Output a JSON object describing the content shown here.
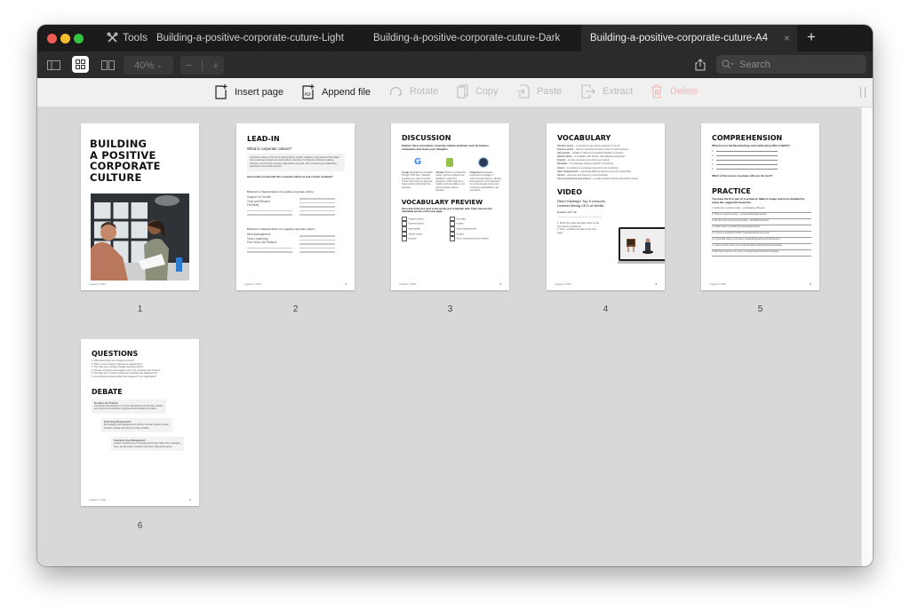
{
  "window": {
    "tools_label": "Tools",
    "tabs": [
      {
        "label": "Building-a-positive-corporate-cuture-Light",
        "active": false
      },
      {
        "label": "Building-a-positive-corporate-cuture-Dark",
        "active": false
      },
      {
        "label": "Building-a-positive-corporate-cuture-A4",
        "active": true
      }
    ],
    "close_glyph": "×",
    "new_tab_glyph": "+"
  },
  "toolbar": {
    "zoom_value": "40%",
    "zoom_out": "−",
    "zoom_in": "+",
    "search_placeholder": "Search"
  },
  "actions": [
    {
      "label": "Insert page",
      "icon": "insert-page-icon",
      "state": "enabled"
    },
    {
      "label": "Append file",
      "icon": "append-pdf-icon",
      "state": "enabled"
    },
    {
      "label": "Rotate",
      "icon": "rotate-icon",
      "state": "disabled"
    },
    {
      "label": "Copy",
      "icon": "copy-icon",
      "state": "disabled"
    },
    {
      "label": "Paste",
      "icon": "paste-icon",
      "state": "disabled"
    },
    {
      "label": "Extract",
      "icon": "extract-icon",
      "state": "disabled"
    },
    {
      "label": "Delete",
      "icon": "trash-icon",
      "state": "disabled"
    }
  ],
  "colors": {
    "titlebar": "#1b1b1b",
    "toolbar": "#2b2b2b",
    "canvas": "#d8d8d8",
    "delete_disabled": "#f1b9b9"
  },
  "pages": [
    {
      "number": "1",
      "title_lines": [
        "BUILDING",
        "A POSITIVE",
        "CORPORATE",
        "CULTURE"
      ],
      "footer": "Linguaco © 2024"
    },
    {
      "number": "2",
      "title": "LEAD-IN",
      "subtitle": "What is corporate culture?",
      "box_text": "Corporate culture is the set of shared values, beliefs, attitudes, and practices that shape how employees interact and work within a company. It influences decision-making, behavior, and how the company approaches its goals, often impacting job satisfaction, teamwork, and overall success.",
      "question": "How would you describe the corporate culture at your current company?",
      "positive_heading": "Brainstorm characteristics of a positive corporate culture:",
      "positive_items": [
        "Support for Growth",
        "Trust and Respect",
        "Flexibility"
      ],
      "negative_heading": "Brainstorm characteristics of a negative corporate culture:",
      "negative_items": [
        "Micromanagement",
        "Toxic Leadership",
        "Poor Work-Life Balance"
      ],
      "page_label": "2",
      "footer": "Linguaco © 2024"
    },
    {
      "number": "3",
      "title": "DISCUSSION",
      "intro": "Explore these innovative corporate culture methods used by famous companies and share your thoughts.",
      "companies": [
        {
          "name": "Google",
          "text": "Emphasizes innovation through \"20% time,\" allowing employees to spend a portion of their work hours on personal projects that could benefit the company."
        },
        {
          "name": "Shopify",
          "text": "Fosters a remote-first culture, giving employees the flexibility to work from anywhere, which supports a healthy work-life balance and accommodates diverse lifestyles."
        },
        {
          "name": "Patagonia",
          "text": "Encourages employees to engage in environmental activism, offering them paid time off to volunteer for environmental causes and promoting sustainability in all operations."
        }
      ],
      "vocab_title": "VOCABULARY PREVIEW",
      "vocab_intro": "Put a tick in the box next to the words you're familiar with. Then, discuss the unfamiliar words on the next page.",
      "vocab_left": [
        "Vacation policy",
        "Expense policy",
        "Appropriate",
        "Global culture",
        "Expand"
      ],
      "vocab_right": [
        "Stimulate",
        "Inspire",
        "Open disagreement",
        "Candor",
        "Act in (someone's) best interest"
      ],
      "page_label": "3",
      "footer": "Linguaco © 2024"
    },
    {
      "number": "4",
      "title": "VOCABULARY",
      "definitions": [
        {
          "term": "Vacation policy",
          "def": "a company's rules about employees' time off"
        },
        {
          "term": "Expense policy",
          "def": "rules on spending company money for work purposes"
        },
        {
          "term": "Appropriate",
          "def": "suitable or fitting for a particular situation or purpose"
        },
        {
          "term": "Global culture",
          "def": "a workplace with diverse, international perspectives"
        },
        {
          "term": "Expand",
          "def": "to grow a business and enter new markets"
        },
        {
          "term": "Stimulate",
          "def": "to encourage activity or growth in something"
        },
        {
          "term": "Inspire",
          "def": "to motivate or encourage someone to do something"
        },
        {
          "term": "Open disagreement",
          "def": "expressing differing opinions freely and respectfully"
        },
        {
          "term": "Candor",
          "def": "openness and honesty in communication"
        },
        {
          "term": "Act in (someone's) best interest",
          "def": "to make decisions that benefit another person"
        }
      ],
      "video_title": "VIDEO",
      "video_heading": "Reed Hasting's Top 5 Lessons Learned Being CEO of Netflix",
      "duration": "Duration 3:37 min",
      "steps": [
        "Watch the video and take notes on the five lessons mentioned.",
        "Then, complete the task on the next page."
      ],
      "page_label": "4",
      "footer": "Linguaco © 2024"
    },
    {
      "number": "5",
      "title": "COMPREHENSION",
      "question": "What lessons did Reed Hastings learn while being CEO of Netflix?",
      "blanks": [
        "1.",
        "2.",
        "3.",
        "4.",
        "5."
      ],
      "resonate": "Which of the lessons resonates with you the most?",
      "practice_title": "PRACTICE",
      "practice_intro": "You have the first part of a sentence. Make it longer and more detailed by using the suggested keywords.",
      "practice_items": [
        "1. Netflix has no vacation policy... (you/take/time off/needs)",
        "2. There's no expense policy... (you/spend/think/appropriate)",
        "3. We have only one five-word principle... (act/Netflix's/interest)",
        "4. Another lesson is (global) (company/global/culture)",
        "5. It's been so exciting for Netflix (expand/decide/last few years)",
        "6. A successful culture is one where (people/disagree/never/forward/center)",
        "7. Leaders should create context and (stimulate/creativity/help/produce/ideas)",
        "8. With high performers, the goal is (motivate/inspire/reflect/micromanage)"
      ],
      "page_label": "5",
      "footer": "Linguaco © 2024"
    },
    {
      "number": "6",
      "title": "QUESTIONS",
      "questions": [
        "1. What values does your company promote?",
        "2. What is your company's approach to vacation time?",
        "3. How does your company manage spending policies?",
        "4. How are employees encouraged to act in the company's best interest?",
        "5. How does your company handle open feedback and disagreement?",
        "6. Are employees inspired rather than managed in your organization?"
      ],
      "debate_title": "DEBATE",
      "debate": [
        {
          "title": "No Rules, No Problem:",
          "text": "Companies should adopt a 'no rules' approach to policies like vacation and expenses to empower employees and stimulate innovation."
        },
        {
          "title": "Embracing Disagreement:",
          "text": "Encouraging open disagreement within a company leads to better decision-making and prevents costly mistakes."
        },
        {
          "title": "Inspiration Over Management:",
          "text": "Leaders should focus on inspiring their teams rather than managing them, as this fosters creativity and drives high performance."
        }
      ],
      "page_label": "6",
      "footer": "Linguaco © 2024"
    }
  ]
}
